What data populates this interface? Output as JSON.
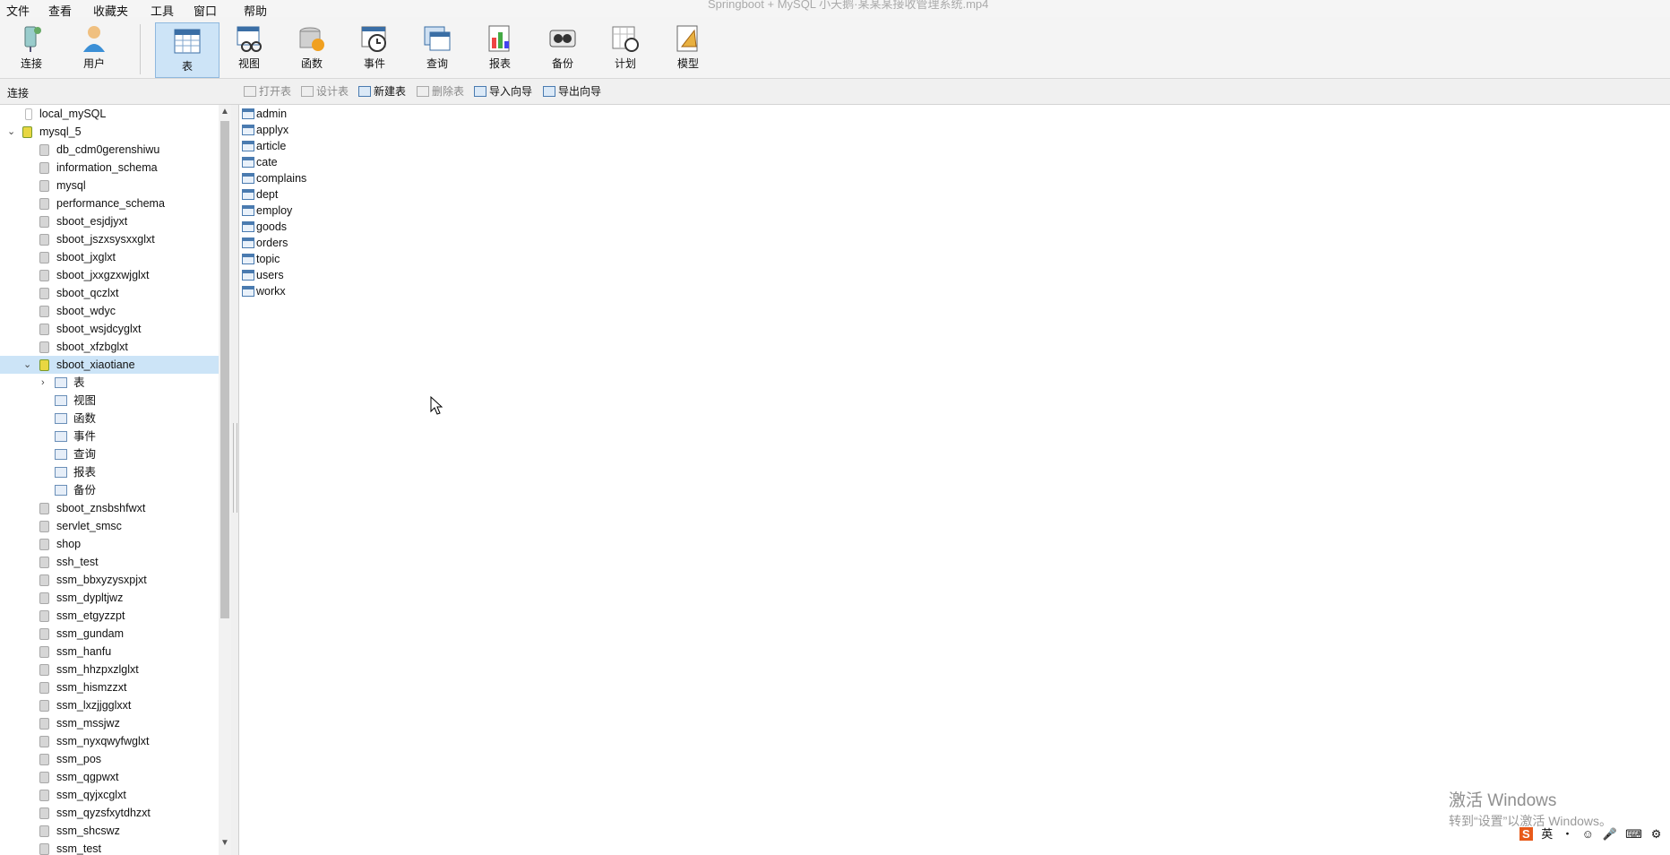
{
  "window": {
    "title": "Springboot + MySQL 小天鹅·某某某接收管理系统.mp4"
  },
  "menu": [
    "文件",
    "查看",
    "收藏夹",
    "工具",
    "窗口",
    "帮助"
  ],
  "toolbar": [
    {
      "label": "连接",
      "icon": "connect-icon"
    },
    {
      "label": "用户",
      "icon": "user-icon"
    },
    {
      "label": "表",
      "icon": "table-icon",
      "active": true
    },
    {
      "label": "视图",
      "icon": "view-icon"
    },
    {
      "label": "函数",
      "icon": "function-icon"
    },
    {
      "label": "事件",
      "icon": "event-icon"
    },
    {
      "label": "查询",
      "icon": "query-icon"
    },
    {
      "label": "报表",
      "icon": "report-icon"
    },
    {
      "label": "备份",
      "icon": "backup-icon"
    },
    {
      "label": "计划",
      "icon": "schedule-icon"
    },
    {
      "label": "模型",
      "icon": "model-icon"
    }
  ],
  "subbar": {
    "connection_label": "连接",
    "actions": [
      {
        "label": "打开表",
        "enabled": false
      },
      {
        "label": "设计表",
        "enabled": false
      },
      {
        "label": "新建表",
        "enabled": true
      },
      {
        "label": "删除表",
        "enabled": false
      },
      {
        "label": "导入向导",
        "enabled": true
      },
      {
        "label": "导出向导",
        "enabled": true
      }
    ]
  },
  "tree": {
    "connections": [
      {
        "name": "local_mySQL",
        "expanded": false
      },
      {
        "name": "mysql_5",
        "expanded": true
      }
    ],
    "databases_before": [
      "db_cdm0gerenshiwu",
      "information_schema",
      "mysql",
      "performance_schema",
      "sboot_esjdjyxt",
      "sboot_jszxsysxxglxt",
      "sboot_jxglxt",
      "sboot_jxxgzxwjglxt",
      "sboot_qczlxt",
      "sboot_wdyc",
      "sboot_wsjdcyglxt",
      "sboot_xfzbglxt"
    ],
    "selected_db": "sboot_xiaotiane",
    "selected_db_children": [
      "表",
      "视图",
      "函数",
      "事件",
      "查询",
      "报表",
      "备份"
    ],
    "databases_after": [
      "sboot_znsbshfwxt",
      "servlet_smsc",
      "shop",
      "ssh_test",
      "ssm_bbxyzysxpjxt",
      "ssm_dypltjwz",
      "ssm_etgyzzpt",
      "ssm_gundam",
      "ssm_hanfu",
      "ssm_hhzpxzlglxt",
      "ssm_hismzzxt",
      "ssm_lxzjjgglxxt",
      "ssm_mssjwz",
      "ssm_nyxqwyfwglxt",
      "ssm_pos",
      "ssm_qgpwxt",
      "ssm_qyjxcglxt",
      "ssm_qyzsfxytdhzxt",
      "ssm_shcswz",
      "ssm_test"
    ]
  },
  "tables": [
    "admin",
    "applyx",
    "article",
    "cate",
    "complains",
    "dept",
    "employ",
    "goods",
    "orders",
    "topic",
    "users",
    "workx"
  ],
  "watermark": {
    "line1": "激活 Windows",
    "line2": "转到“设置”以激活 Windows。"
  },
  "tray": [
    "英",
    "・",
    "☺",
    "🎤",
    "⌨",
    "⚙"
  ]
}
